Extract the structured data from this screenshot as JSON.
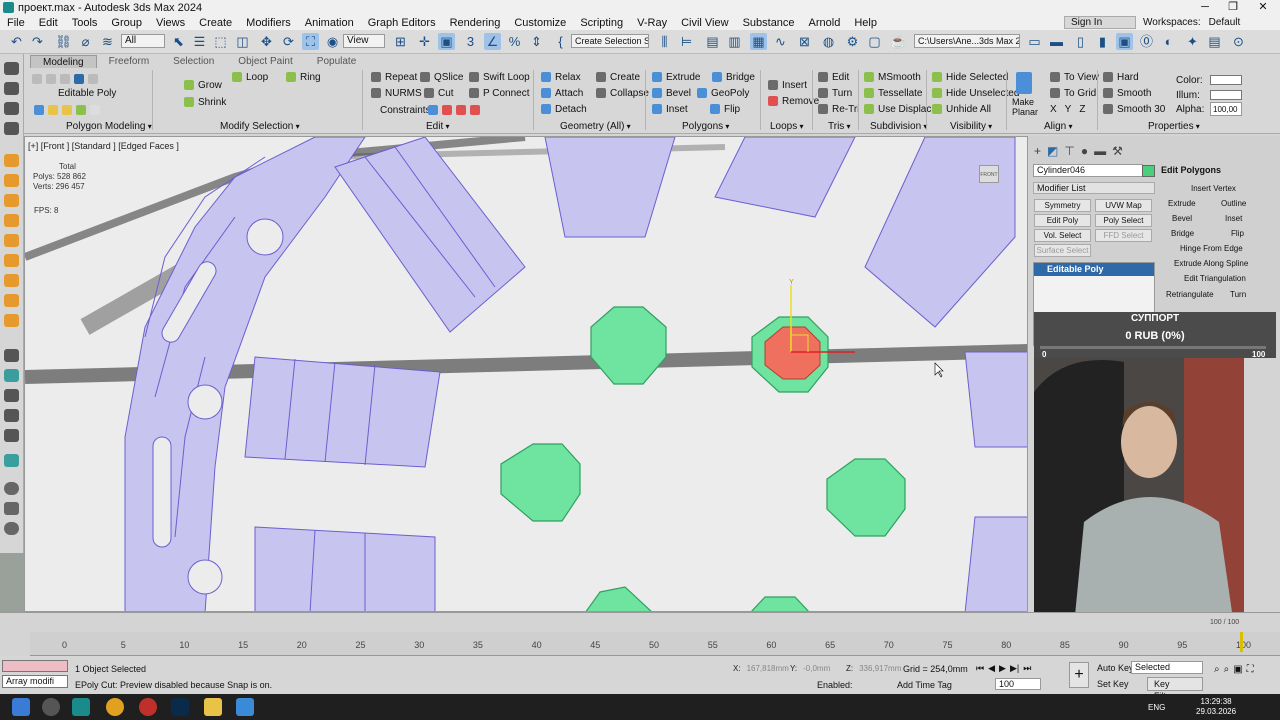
{
  "window": {
    "title": "проект.max - Autodesk 3ds Max 2024",
    "min": "─",
    "max": "❐",
    "close": "✕"
  },
  "menu": [
    "File",
    "Edit",
    "Tools",
    "Group",
    "Views",
    "Create",
    "Modifiers",
    "Animation",
    "Graph Editors",
    "Rendering",
    "Customize",
    "Scripting",
    "V-Ray",
    "Civil View",
    "Substance",
    "Arnold",
    "Help"
  ],
  "account": {
    "signin": "Sign In",
    "workspaces_label": "Workspaces:",
    "workspace": "Default"
  },
  "toolbar": {
    "selection_filter": "All",
    "reference_coord": "View",
    "named_selection": "Create Selection Se",
    "project_path": "C:\\Users\\Ane...3ds Max 2024"
  },
  "ribbon": {
    "tabs": [
      "Modeling",
      "Freeform",
      "Selection",
      "Object Paint",
      "Populate"
    ],
    "active_tab": "Modeling",
    "subobject": "Editable Poly",
    "modify_selection": [
      "Grow",
      "Shrink",
      "Loop",
      "Ring"
    ],
    "edit": [
      "Repeat",
      "QSlice",
      "Swift Loop",
      "NURMS",
      "Cut",
      "P Connect",
      "Constraints:"
    ],
    "geometry": [
      "Relax",
      "Create",
      "Attach",
      "Collapse",
      "Detach"
    ],
    "polygons": [
      "Extrude",
      "Bridge",
      "Bevel",
      "GeoPoly",
      "Inset",
      "Flip"
    ],
    "loops": [
      "Insert",
      "Remove"
    ],
    "tris": [
      "Edit",
      "Turn",
      "Re-Tri"
    ],
    "subdivision": [
      "MSmooth",
      "Tessellate",
      "Use Displac..."
    ],
    "visibility": [
      "Hide Selected",
      "Hide Unselected",
      "Unhide All"
    ],
    "align": [
      "Make Planar",
      "To View",
      "To Grid",
      "X",
      "Y",
      "Z"
    ],
    "properties": [
      "Hard",
      "Smooth",
      "Smooth 30",
      "Color:",
      "Illum:",
      "Alpha:",
      "100,00"
    ],
    "groups": [
      "Polygon Modeling",
      "Modify Selection",
      "Edit",
      "Geometry (All)",
      "Polygons",
      "Loops",
      "Tris",
      "Subdivision",
      "Visibility",
      "Align",
      "Properties"
    ]
  },
  "viewport": {
    "label": "[+] [Front ] [Standard ] [Edged Faces ]",
    "stats_total": "Total",
    "polys": "Polys: 528 862",
    "verts": "Verts: 296 457",
    "fps": "FPS:   8",
    "viewcube": "FRONT"
  },
  "command_panel": {
    "object_name": "Cylinder046",
    "modifier_list": "Modifier List",
    "buttons": [
      "Symmetry",
      "UVW Map",
      "Edit Poly",
      "Poly Select",
      "Vol. Select",
      "FFD Select",
      "Surface Select"
    ],
    "stack_item": "Editable Poly",
    "edit_polygons_title": "Edit Polygons",
    "edit_polygons": [
      "Insert Vertex",
      "Extrude",
      "Outline",
      "Bevel",
      "Inset",
      "Bridge",
      "Flip",
      "Hinge From Edge",
      "Extrude Along Spline",
      "Edit Triangulation",
      "Retriangulate",
      "Turn"
    ]
  },
  "stream": {
    "support": "СУППОРТ",
    "amount": "0 RUB (0%)",
    "min": "0",
    "max": "100",
    "progress_fraction": 0
  },
  "time": {
    "slider": "100 / 100",
    "ticks": [
      "0",
      "5",
      "10",
      "15",
      "20",
      "25",
      "30",
      "35",
      "40",
      "45",
      "50",
      "55",
      "60",
      "65",
      "70",
      "75",
      "80",
      "85",
      "90",
      "95",
      "100"
    ]
  },
  "status": {
    "maxscript": "Array modifi",
    "selected": "1 Object Selected",
    "prompt": "EPoly Cut: Preview disabled because Snap is on.",
    "x_label": "X:",
    "x": "167,818mm",
    "y_label": "Y:",
    "y": "-0,0mm",
    "z_label": "Z:",
    "z": "336,917mm",
    "grid": "Grid = 254,0mm",
    "enabled": "Enabled:",
    "add_time_tag": "Add Time Tag",
    "auto_key": "Auto Key",
    "selected_set": "Selected",
    "set_key": "Set Key",
    "key_filters": "Key Filters...",
    "frame": "100"
  },
  "taskbar": {
    "lang": "ENG",
    "time": "13:29:38",
    "date": "29.03.2026"
  },
  "colors": {
    "poly_fill": "#c8c4f0",
    "poly_edge": "#6a5fd0",
    "gem_fill": "#6fe3a0",
    "gem_selected": "#f07060"
  }
}
